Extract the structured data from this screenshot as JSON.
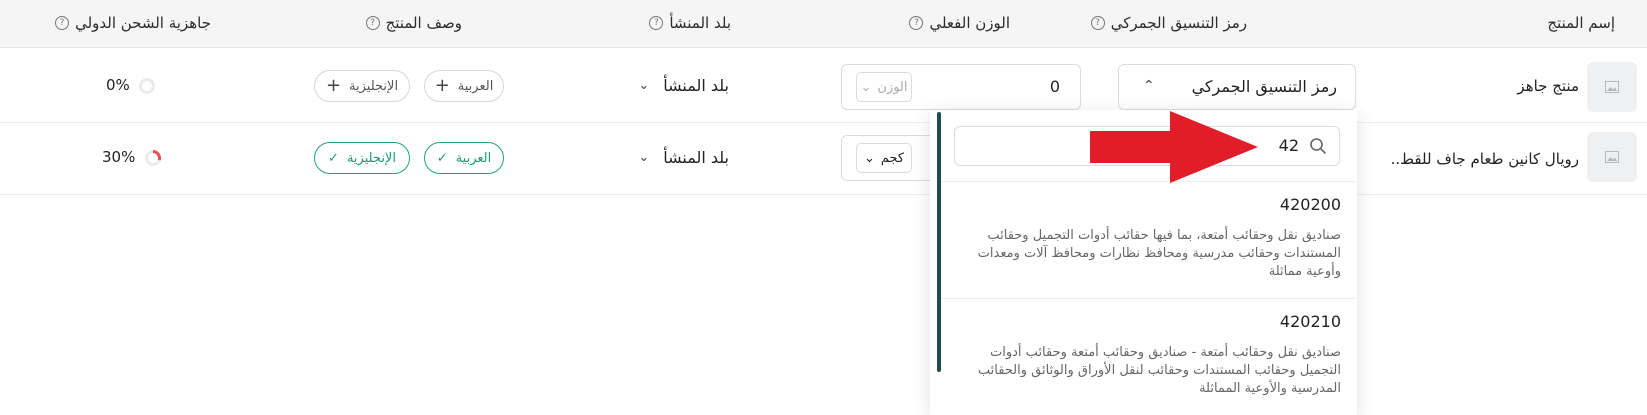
{
  "columns": {
    "product_name": "إسم المنتج",
    "hs_code": "رمز التنسيق الجمركي",
    "actual_weight": "الوزن الفعلي",
    "origin": "بلد المنشأ",
    "description": "وصف المنتج",
    "readiness": "جاهزية الشحن الدولي"
  },
  "rows": [
    {
      "name": "منتج جاهز",
      "hs_placeholder": "رمز التنسيق الجمركي",
      "weight_value": "0",
      "weight_unit": "الوزن",
      "origin": "بلد المنشأ",
      "desc_ar": "العربية",
      "desc_en": "الإنجليزية",
      "readiness": "0%",
      "readiness_value": 0
    },
    {
      "name": "رويال كانين طعام جاف للقط..",
      "weight_unit": "كجم",
      "origin": "بلد المنشأ",
      "desc_ar": "العربية",
      "desc_en": "الإنجليزية",
      "readiness": "30%",
      "readiness_value": 30
    }
  ],
  "dropdown": {
    "search_value": "42",
    "options": [
      {
        "code": "420200",
        "description": "صناديق نقل وحقائب أمتعة، بما فيها حقائب أدوات التجميل وحقائب المستندات وحقائب مدرسية ومحافظ نظارات ومحافظ آلات ومعدات وأوعية مماثلة"
      },
      {
        "code": "420210",
        "description": "صناديق نقل وحقائب أمتعة - صناديق وحقائب أمتعة وحقائب أدوات التجميل وحقائب المستندات وحقائب لنقل الأوراق والوثائق والحقائب المدرسية والأوعية المماثلة"
      }
    ]
  },
  "colors": {
    "accent_green": "#1c9a72",
    "progress_red": "#e85050",
    "annotation_arrow": "#e11d2a",
    "scroll_bar": "#1f4e4a"
  },
  "icons": {
    "help": "help-circle-icon",
    "chevron_up": "chevron-up-icon",
    "chevron_down": "chevron-down-icon",
    "plus": "plus-icon",
    "check": "check-icon",
    "search": "search-icon",
    "image_placeholder": "image-placeholder-icon"
  }
}
